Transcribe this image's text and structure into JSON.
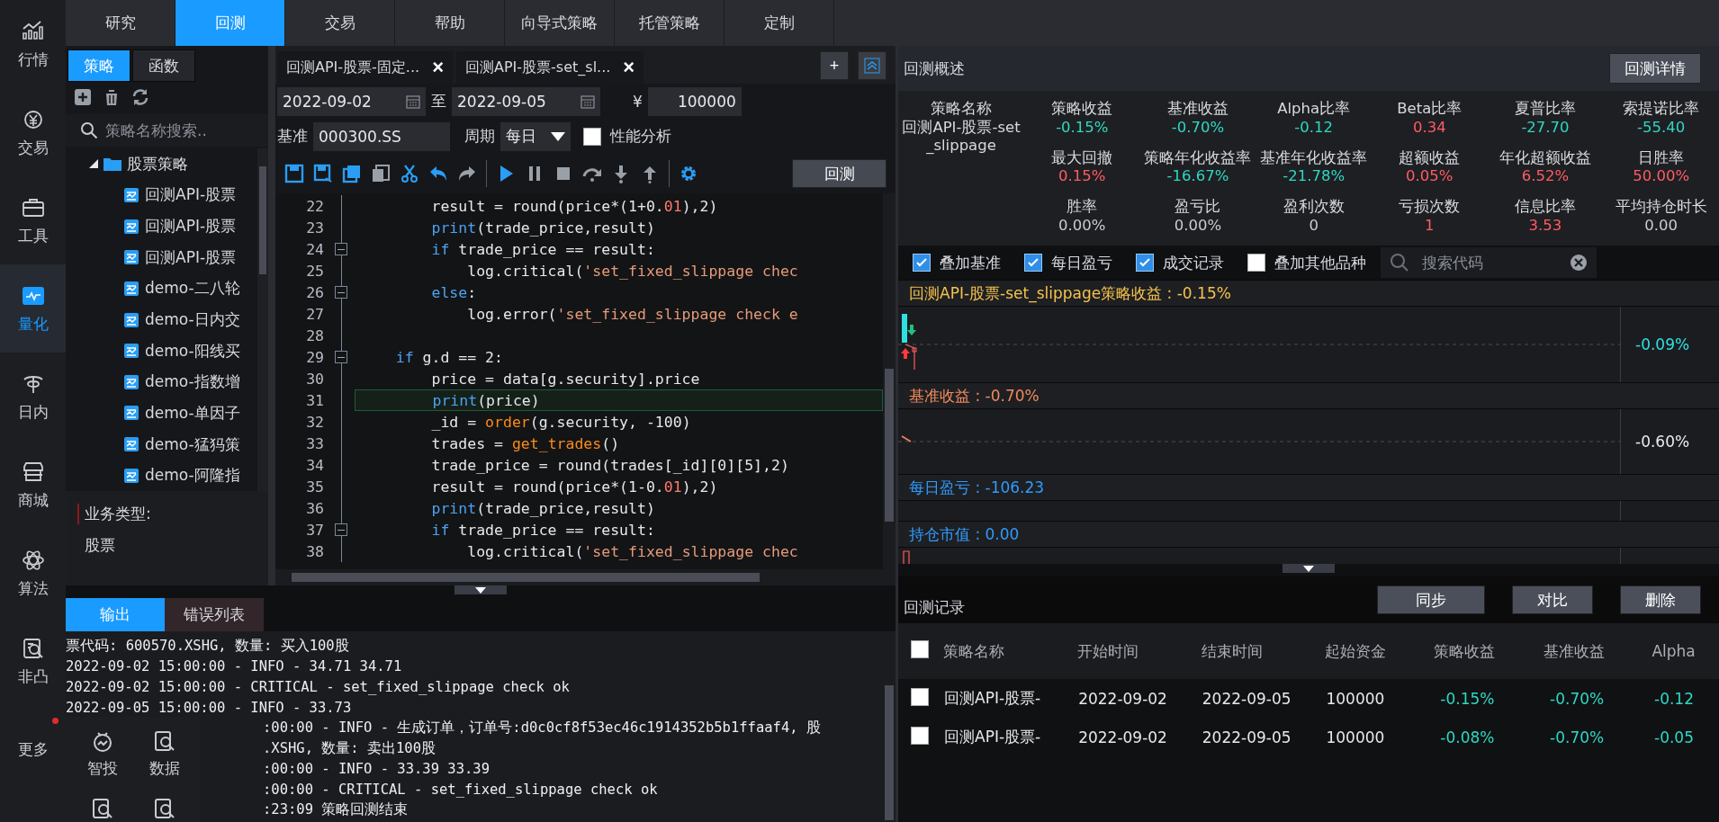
{
  "nav": {
    "items": [
      {
        "label": "行情",
        "selected": false,
        "notification": false
      },
      {
        "label": "交易",
        "selected": false,
        "notification": false
      },
      {
        "label": "工具",
        "selected": false,
        "notification": false
      },
      {
        "label": "量化",
        "selected": true,
        "notification": false
      },
      {
        "label": "日内",
        "selected": false,
        "notification": false
      },
      {
        "label": "商城",
        "selected": false,
        "notification": false
      },
      {
        "label": "算法",
        "selected": false,
        "notification": false
      },
      {
        "label": "非凸",
        "selected": false,
        "notification": false
      },
      {
        "label": "更多",
        "selected": false,
        "notification": true
      }
    ]
  },
  "top_tabs": [
    {
      "label": "研究",
      "selected": false
    },
    {
      "label": "回测",
      "selected": true
    },
    {
      "label": "交易",
      "selected": false
    },
    {
      "label": "帮助",
      "selected": false
    },
    {
      "label": "向导式策略",
      "selected": false
    },
    {
      "label": "托管策略",
      "selected": false
    },
    {
      "label": "定制",
      "selected": false
    }
  ],
  "strategy_panel": {
    "tabs": [
      {
        "label": "策略",
        "selected": true
      },
      {
        "label": "函数",
        "selected": false
      }
    ],
    "search": {
      "placeholder": "策略名称搜索.."
    },
    "tree": [
      {
        "label": "股票策略",
        "expanded": true,
        "children": [
          {
            "label": "回测API-股票"
          },
          {
            "label": "回测API-股票"
          },
          {
            "label": "回测API-股票"
          },
          {
            "label": "demo-二八轮"
          },
          {
            "label": "demo-日内交"
          },
          {
            "label": "demo-阳线买"
          },
          {
            "label": "demo-指数增"
          },
          {
            "label": "demo-单因子"
          },
          {
            "label": "demo-猛犸策"
          },
          {
            "label": "demo-阿隆指"
          }
        ]
      }
    ],
    "business": {
      "label": "业务类型:",
      "value": "股票"
    }
  },
  "editor": {
    "file_tabs": [
      {
        "label": "回测API-股票-固定...",
        "close": "×"
      },
      {
        "label": "回测API-股票-set_sl...",
        "close": "×"
      }
    ],
    "add_button": "+",
    "start_date": "2022-09-02",
    "to": "至",
    "end_date": "2022-09-05",
    "currency": "¥",
    "capital": "100000",
    "benchmark_label": "基准",
    "benchmark": "000300.SS",
    "period_label": "周期",
    "period": "每日",
    "performance": {
      "label": "性能分析",
      "checked": false
    },
    "run_button": "回测",
    "lines": [
      {
        "num": "22",
        "fold": false,
        "highlighted": false,
        "tokens": [
          {
            "text": "        result = round(price*(1+0.",
            "kind": "plain"
          },
          {
            "text": "01",
            "kind": "num"
          },
          {
            "text": "),2)",
            "kind": "plain"
          }
        ]
      },
      {
        "num": "23",
        "fold": false,
        "highlighted": false,
        "tokens": [
          {
            "text": "        print",
            "kind": "kw"
          },
          {
            "text": "(trade_price,result)",
            "kind": "plain"
          }
        ]
      },
      {
        "num": "24",
        "fold": true,
        "highlighted": false,
        "tokens": [
          {
            "text": "        if",
            "kind": "kw"
          },
          {
            "text": " trade_price == result:",
            "kind": "plain"
          }
        ]
      },
      {
        "num": "25",
        "fold": false,
        "highlighted": false,
        "tokens": [
          {
            "text": "            log.critical(",
            "kind": "plain"
          },
          {
            "text": "'set_fixed_slippage chec",
            "kind": "str"
          }
        ]
      },
      {
        "num": "26",
        "fold": true,
        "highlighted": false,
        "tokens": [
          {
            "text": "        else",
            "kind": "kw"
          },
          {
            "text": ":",
            "kind": "plain"
          }
        ]
      },
      {
        "num": "27",
        "fold": false,
        "highlighted": false,
        "tokens": [
          {
            "text": "            log.error(",
            "kind": "plain"
          },
          {
            "text": "'set_fixed_slippage check e",
            "kind": "str"
          }
        ]
      },
      {
        "num": "28",
        "fold": false,
        "highlighted": false
      },
      {
        "num": "29",
        "fold": true,
        "highlighted": false,
        "tokens": [
          {
            "text": "    if",
            "kind": "kw"
          },
          {
            "text": " g.d == 2:",
            "kind": "plain"
          }
        ]
      },
      {
        "num": "30",
        "fold": false,
        "highlighted": false,
        "tokens": [
          {
            "text": "        price = data[g.security].price",
            "kind": "plain"
          }
        ]
      },
      {
        "num": "31",
        "fold": false,
        "highlighted": true,
        "tokens": [
          {
            "text": "        print",
            "kind": "kw"
          },
          {
            "text": "(price)",
            "kind": "plain"
          }
        ]
      },
      {
        "num": "32",
        "fold": false,
        "highlighted": false,
        "tokens": [
          {
            "text": "        _id = ",
            "kind": "plain"
          },
          {
            "text": "order",
            "kind": "fn"
          },
          {
            "text": "(g.security, -100)",
            "kind": "plain"
          }
        ]
      },
      {
        "num": "33",
        "fold": false,
        "highlighted": false,
        "tokens": [
          {
            "text": "        trades = ",
            "kind": "plain"
          },
          {
            "text": "get_trades",
            "kind": "fn"
          },
          {
            "text": "()",
            "kind": "plain"
          }
        ]
      },
      {
        "num": "34",
        "fold": false,
        "highlighted": false,
        "tokens": [
          {
            "text": "        trade_price = round(trades[_id][0][5],2)",
            "kind": "plain"
          }
        ]
      },
      {
        "num": "35",
        "fold": false,
        "highlighted": false,
        "tokens": [
          {
            "text": "        result = round(price*(1-0.",
            "kind": "plain"
          },
          {
            "text": "01",
            "kind": "num"
          },
          {
            "text": "),2)",
            "kind": "plain"
          }
        ]
      },
      {
        "num": "36",
        "fold": false,
        "highlighted": false,
        "tokens": [
          {
            "text": "        print",
            "kind": "kw"
          },
          {
            "text": "(trade_price,result)",
            "kind": "plain"
          }
        ]
      },
      {
        "num": "37",
        "fold": true,
        "highlighted": false,
        "tokens": [
          {
            "text": "        if",
            "kind": "kw"
          },
          {
            "text": " trade_price == result:",
            "kind": "plain"
          }
        ]
      },
      {
        "num": "38",
        "fold": false,
        "highlighted": false,
        "tokens": [
          {
            "text": "            log.critical(",
            "kind": "plain"
          },
          {
            "text": "'set_fixed_slippage chec",
            "kind": "str"
          }
        ]
      }
    ]
  },
  "console": {
    "tabs": [
      {
        "label": "输出",
        "selected": true
      },
      {
        "label": "错误列表",
        "selected": false
      }
    ],
    "lines": [
      {
        "text": "票代码: 600570.XSHG, 数量: 买入100股",
        "covered": false
      },
      {
        "text": "2022-09-02 15:00:00 - INFO - 34.71 34.71",
        "covered": false
      },
      {
        "text": "2022-09-02 15:00:00 - CRITICAL - set_fixed_slippage check ok",
        "covered": false
      },
      {
        "text": "2022-09-05 15:00:00 - INFO - 33.73",
        "covered": false
      },
      {
        "text": ":00:00 - INFO - 生成订单，订单号:d0c0cf8f53ec46c1914352b5b1ffaaf4, 股",
        "covered": true
      },
      {
        "text": ".XSHG, 数量: 卖出100股",
        "covered": true
      },
      {
        "text": ":00:00 - INFO - 33.39 33.39",
        "covered": true
      },
      {
        "text": ":00:00 - CRITICAL - set_fixed_slippage check ok",
        "covered": true
      },
      {
        "text": ":23:09 策略回测结束",
        "covered": true
      }
    ]
  },
  "more_menu": {
    "items": [
      {
        "label": "智投"
      },
      {
        "label": "数据"
      }
    ]
  },
  "overview": {
    "title": "回测概述",
    "detail_button": "回测详情",
    "name_label": "策略名称",
    "name_value": "回测API-股票-set_slippage",
    "stats": [
      {
        "label": "策略收益",
        "value": "-0.15%",
        "color": "#2ed8c3"
      },
      {
        "label": "基准收益",
        "value": "-0.70%",
        "color": "#2ed8c3"
      },
      {
        "label": "Alpha比率",
        "value": "-0.12",
        "color": "#2ed8c3"
      },
      {
        "label": "Beta比率",
        "value": "0.34",
        "color": "#ff5c64"
      },
      {
        "label": "夏普比率",
        "value": "-27.70",
        "color": "#2ed8c3"
      },
      {
        "label": "索提诺比率",
        "value": "-55.40",
        "color": "#2ed8c3"
      },
      {
        "label": "最大回撤",
        "value": "0.15%",
        "color": "#ff5c64"
      },
      {
        "label": "策略年化收益率",
        "value": "-16.67%",
        "color": "#2ed8c3"
      },
      {
        "label": "基准年化收益率",
        "value": "-21.78%",
        "color": "#2ed8c3"
      },
      {
        "label": "超额收益",
        "value": "0.05%",
        "color": "#ff5c64"
      },
      {
        "label": "年化超额收益",
        "value": "6.52%",
        "color": "#ff5c64"
      },
      {
        "label": "日胜率",
        "value": "50.00%",
        "color": "#ff5c64"
      },
      {
        "label": "胜率",
        "value": "0.00%",
        "color": "#c8ccd2"
      },
      {
        "label": "盈亏比",
        "value": "0.00%",
        "color": "#c8ccd2"
      },
      {
        "label": "盈利次数",
        "value": "0",
        "color": "#c8ccd2"
      },
      {
        "label": "亏损次数",
        "value": "1",
        "color": "#ff5c64"
      },
      {
        "label": "信息比率",
        "value": "3.53",
        "color": "#ff5c64"
      },
      {
        "label": "平均持仓时长",
        "value": "0.00",
        "color": "#c8ccd2"
      }
    ]
  },
  "overlays": [
    {
      "label": "叠加基准",
      "checked": true
    },
    {
      "label": "每日盈亏",
      "checked": true
    },
    {
      "label": "成交记录",
      "checked": true
    },
    {
      "label": "叠加其他品种",
      "checked": false
    }
  ],
  "code_search": {
    "placeholder": "搜索代码"
  },
  "charts": [
    {
      "kind": "candles",
      "title": "回测API-股票-set_slippage策略收益 : -0.15%",
      "color": "#f5c24c",
      "axis_label": "-0.09%"
    },
    {
      "kind": "line",
      "title": "基准收益 : -0.70%",
      "color": "#f08a5d",
      "axis_label": "-0.60%"
    },
    {
      "kind": "bars",
      "title": "每日盈亏 : -106.23",
      "color": "#2f9bff"
    },
    {
      "kind": "position",
      "title": "持仓市值 : 0.00",
      "color": "#2f9bff"
    }
  ],
  "records": {
    "title": "回测记录",
    "buttons": [
      "同步",
      "对比",
      "删除"
    ],
    "header_checked": false,
    "columns": [
      {
        "label": "策略名称",
        "kind": "text"
      },
      {
        "label": "开始时间",
        "kind": "text"
      },
      {
        "label": "结束时间",
        "kind": "text"
      },
      {
        "label": "起始资金",
        "kind": "text"
      },
      {
        "label": "策略收益",
        "kind": "return"
      },
      {
        "label": "基准收益",
        "kind": "return"
      },
      {
        "label": "Alpha",
        "kind": "return"
      }
    ],
    "rows": [
      {
        "checked": false,
        "cells": [
          "回测API-股票-",
          "2022-09-02",
          "2022-09-05",
          "100000",
          "-0.15%",
          "-0.70%",
          "-0.12"
        ]
      },
      {
        "checked": false,
        "cells": [
          "回测API-股票-",
          "2022-09-02",
          "2022-09-05",
          "100000",
          "-0.08%",
          "-0.70%",
          "-0.05"
        ]
      }
    ]
  }
}
